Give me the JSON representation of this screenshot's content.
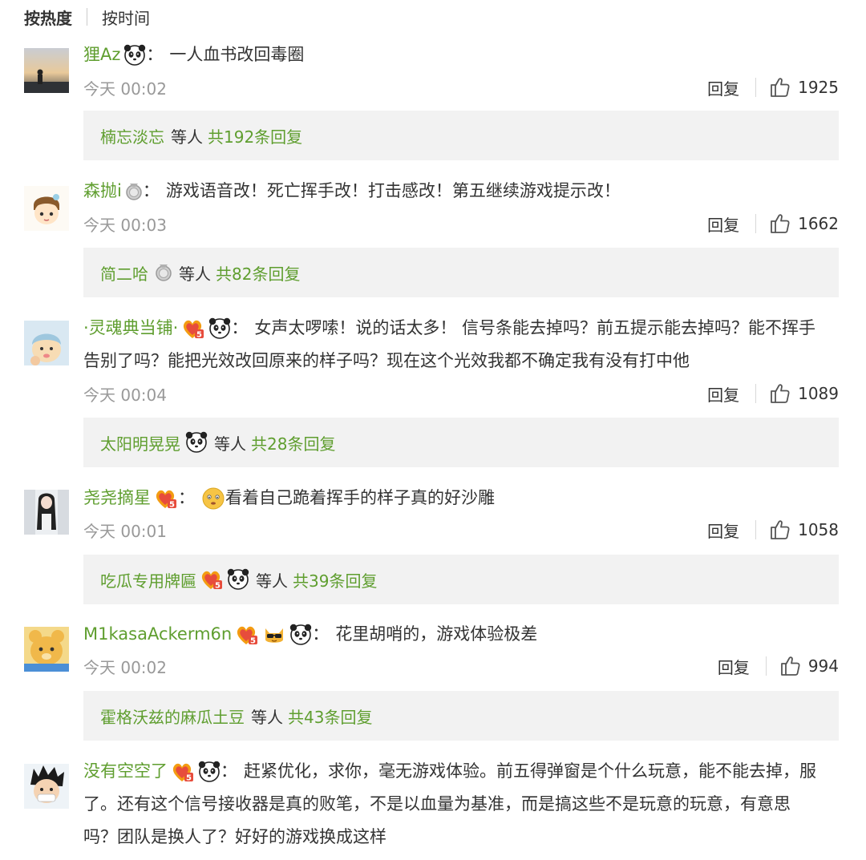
{
  "sort": {
    "active": "按热度",
    "other": "按时间"
  },
  "reply_label": "回复",
  "others_label": "等人",
  "comments": [
    {
      "user": "狸Az",
      "text": "一人血书改回毒圈",
      "time": "今天 00:02",
      "likes": "1925",
      "sub": {
        "name": "楠忘淡忘",
        "count": "共192条回复"
      }
    },
    {
      "user": "森抛i",
      "text": "游戏语音改！死亡挥手改！打击感改！第五继续游戏提示改！",
      "time": "今天 00:03",
      "likes": "1662",
      "sub": {
        "name": "简二哈",
        "count": "共82条回复"
      }
    },
    {
      "user": "·灵魂典当铺·",
      "text_line1": "女声太啰嗦！说的话太多！ 信号条能去掉吗？前五提示能去掉吗？能不挥手",
      "text_line2": "告别了吗？能把光效改回原来的样子吗？现在这个光效我都不确定我有没有打中他",
      "time": "今天 00:04",
      "likes": "1089",
      "sub": {
        "name": "太阳明晃晃",
        "count": "共28条回复"
      }
    },
    {
      "user": "尧尧摘星",
      "text": "看着自己跪着挥手的样子真的好沙雕",
      "time": "今天 00:01",
      "likes": "1058",
      "sub": {
        "name": "吃瓜专用牌匾",
        "count": "共39条回复"
      }
    },
    {
      "user": "M1kasaAckerm6n",
      "text": "花里胡哨的，游戏体验极差",
      "time": "今天 00:02",
      "likes": "994",
      "sub": {
        "name": "霍格沃兹的麻瓜土豆",
        "count": "共43条回复"
      }
    },
    {
      "user": "没有空空了",
      "text_line1": "赶紧优化，求你，毫无游戏体验。前五得弹窗是个什么玩意，能不能去掉，服",
      "text_line2": "了。还有这个信号接收器是真的败笔，不是以血量为基准，而是搞这些不是玩意的玩意，有意思",
      "text_line3": "吗？团队是换人了？好好的游戏换成这样"
    }
  ],
  "colors": {
    "username": "#5f9e2f",
    "meta": "#999999",
    "subbox_bg": "#f2f2f2"
  }
}
